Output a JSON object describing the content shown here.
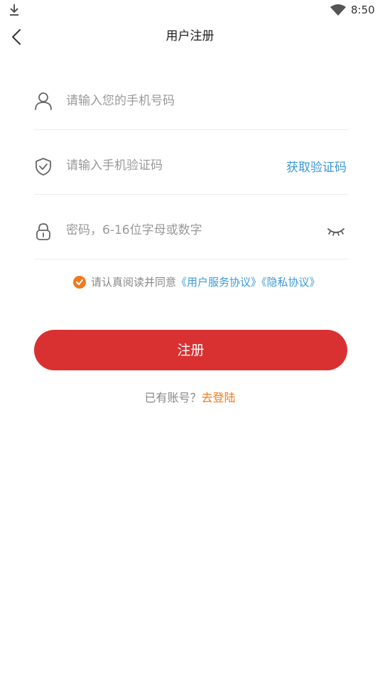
{
  "status_bar": {
    "time": "8:50",
    "icons": [
      "download-icon",
      "wifi-icon"
    ]
  },
  "nav": {
    "title": "用户注册",
    "back_icon": "chevron-left-icon"
  },
  "form": {
    "phone": {
      "icon": "user-icon",
      "placeholder": "请输入您的手机号码",
      "value": ""
    },
    "code": {
      "icon": "shield-check-icon",
      "placeholder": "请输入手机验证码",
      "value": "",
      "get_code_label": "获取验证码"
    },
    "password": {
      "icon": "lock-icon",
      "placeholder": "密码，6-16位字母或数字",
      "value": "",
      "toggle_icon": "eye-closed-icon"
    }
  },
  "agreement": {
    "checked": true,
    "prefix": "请认真阅读并同意",
    "user_agreement": "《用户服务协议》",
    "privacy_policy": "《隐私协议》"
  },
  "register_label": "注册",
  "login_prompt": {
    "text": "已有账号？",
    "link": "去登陆"
  },
  "colors": {
    "primary_red": "#d93131",
    "accent_orange": "#f07a1e",
    "link_blue": "#3a9ad9",
    "placeholder_gray": "#999999"
  }
}
